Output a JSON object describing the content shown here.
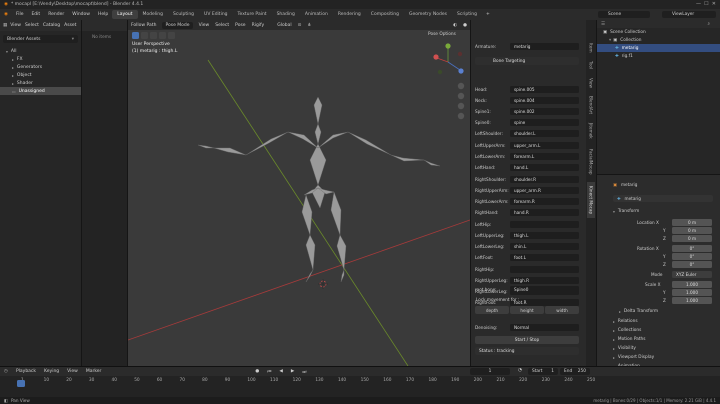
{
  "titlebar": {
    "title": "* mocapl [E:\\Vendy\\Desktop\\mocapt\\blend] - Blender 4.4.1"
  },
  "menu": [
    "File",
    "Edit",
    "Render",
    "Window",
    "Help"
  ],
  "workspaces": [
    "Layout",
    "Modeling",
    "Sculpting",
    "UV Editing",
    "Texture Paint",
    "Shading",
    "Animation",
    "Rendering",
    "Compositing",
    "Geometry Nodes",
    "Scripting"
  ],
  "scene": {
    "label": "Scene",
    "viewlayer": "ViewLayer"
  },
  "assets": {
    "header": "Blender Assets",
    "no_items": "No items",
    "menu": [
      "View",
      "Select",
      "Catalog",
      "Asset"
    ],
    "tree": [
      "All",
      "FX",
      "Generators",
      "Object",
      "Shader",
      "Unassigned"
    ]
  },
  "viewport": {
    "menu": [
      "Follow Path",
      "Pose Mode",
      "View",
      "Select",
      "Pose",
      "Rigify"
    ],
    "transform": "Global",
    "pose_options": "Pose Options",
    "perspective": "User Perspective",
    "active": "(1) metarig : thigh.L"
  },
  "npanel": {
    "armature_label": "Armature:",
    "armature_value": "metarig",
    "bone_targeting": "Bone Targeting",
    "bones": [
      {
        "label": "Head:",
        "value": "spine.005"
      },
      {
        "label": "Neck:",
        "value": "spine.004"
      },
      {
        "label": "Spine1:",
        "value": "spine.002"
      },
      {
        "label": "Spine0:",
        "value": "spine"
      },
      {
        "label": "LeftShoulder:",
        "value": "shoulder.L"
      },
      {
        "label": "LeftUpperArm:",
        "value": "upper_arm.L"
      },
      {
        "label": "LeftLowerArm:",
        "value": "forearm.L"
      },
      {
        "label": "LeftHand:",
        "value": "hand.L"
      },
      {
        "label": "RightShoulder:",
        "value": "shoulder.R"
      },
      {
        "label": "RightUpperArm:",
        "value": "upper_arm.R"
      },
      {
        "label": "RightLowerArm:",
        "value": "forearm.R"
      },
      {
        "label": "RightHand:",
        "value": "hand.R"
      },
      {
        "label": "LeftHip:",
        "value": ""
      },
      {
        "label": "LeftUpperLeg:",
        "value": "thigh.L"
      },
      {
        "label": "LeftLowerLeg:",
        "value": "shin.L"
      },
      {
        "label": "LeftFoot:",
        "value": "foot.L"
      },
      {
        "label": "RightHip:",
        "value": ""
      },
      {
        "label": "RightUpperLeg:",
        "value": "thigh.R"
      },
      {
        "label": "RightLowerLeg:",
        "value": "shin.R"
      },
      {
        "label": "RightFoot:",
        "value": "foot.R"
      },
      {
        "label": "root bone:",
        "value": "Spine0"
      }
    ],
    "lock_label": "Lock movement for :",
    "lock_options": [
      "depth",
      "height",
      "width"
    ],
    "denoising_label": "Denoising:",
    "denoising_value": "Normal",
    "start_stop": "Start / Stop",
    "status": "Status : tracking",
    "tabs": [
      "Item",
      "Tool",
      "View",
      "BlendArt",
      "Jitemek",
      "FacialMocap",
      "Kinect Mocap"
    ]
  },
  "outliner": {
    "header": "Scene Collection",
    "rows": [
      "Collection",
      "metarig",
      "rig.f1"
    ]
  },
  "properties": {
    "object_name": "metarig",
    "data_name": "metarig",
    "transform": "Transform",
    "location_label": "Location X",
    "location": {
      "x": "0 m",
      "y": "0 m",
      "z": "0 m"
    },
    "rotation_label": "Rotation X",
    "rotation": {
      "x": "0°",
      "y": "0°",
      "z": "0°"
    },
    "mode_label": "Mode",
    "mode_value": "XYZ Euler",
    "scale_label": "Scale X",
    "scale": {
      "x": "1.000",
      "y": "1.000",
      "z": "1.000"
    },
    "axis_y": "Y",
    "axis_z": "Z",
    "sections": [
      "Delta Transform",
      "Relations",
      "Collections",
      "Motion Paths",
      "Visibility",
      "Viewport Display",
      "Animation",
      "Custom Properties"
    ]
  },
  "timeline": {
    "menu": [
      "Playback",
      "Keying",
      "View",
      "Marker"
    ],
    "current_frame": "1",
    "start_label": "Start",
    "start": "1",
    "end_label": "End",
    "end": "250",
    "ticks": [
      "1",
      "10",
      "20",
      "30",
      "40",
      "50",
      "60",
      "70",
      "80",
      "90",
      "100",
      "110",
      "120",
      "130",
      "140",
      "150",
      "160",
      "170",
      "180",
      "190",
      "200",
      "210",
      "220",
      "230",
      "240",
      "250"
    ]
  },
  "status": {
    "left": "Pan View",
    "right": "metarig | Bones:0/29 | Objects:1/1 | Memory: 2.21 GiB | 4.4.1"
  },
  "colors": {
    "accent": "#4772b3",
    "bone": "#9a9a9a",
    "x_axis": "#a83a3a",
    "y_axis": "#6a8a2a"
  }
}
